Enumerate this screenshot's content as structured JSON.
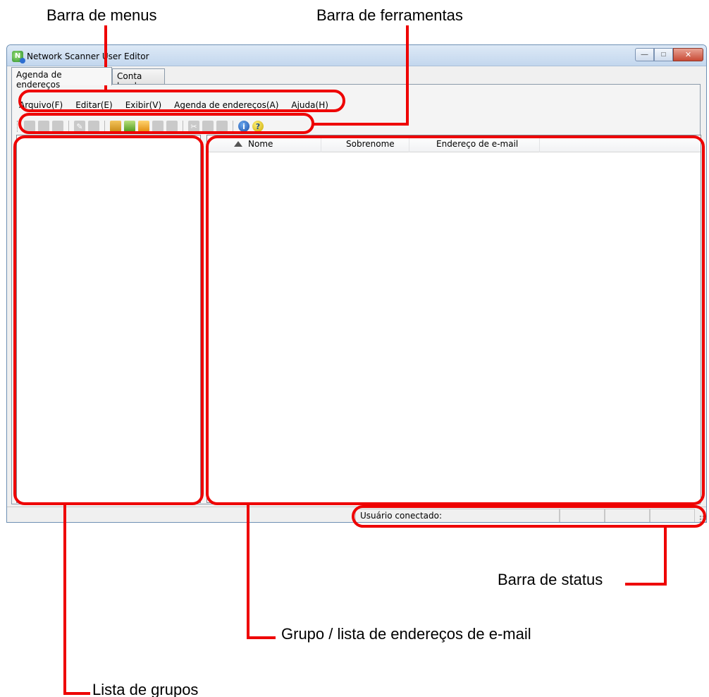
{
  "callouts": {
    "menubar": "Barra de menus",
    "toolbar": "Barra de ferramentas",
    "statusbar": "Barra de status",
    "address_list": "Grupo / lista de endereços de e-mail",
    "group_list": "Lista de grupos"
  },
  "window": {
    "title": "Network Scanner User Editor",
    "buttons": [
      "minimize",
      "maximize",
      "close"
    ]
  },
  "tabs": [
    {
      "label": "Agenda de endereços",
      "active": true
    },
    {
      "label": "Conta local",
      "active": false
    }
  ],
  "menubar": {
    "items": [
      "Arquivo(F)",
      "Editar(E)",
      "Exibir(V)",
      "Agenda de endereços(A)",
      "Ajuda(H)"
    ]
  },
  "toolbar": {
    "icons": [
      "new-user-icon",
      "new-group-icon",
      "add-member-icon",
      "edit-icon",
      "delete-icon",
      "import-icon",
      "open-book-icon",
      "open-folder-icon",
      "print-icon",
      "save-icon",
      "cut-icon",
      "copy-icon",
      "paste-icon",
      "info-icon",
      "help-icon"
    ]
  },
  "address_table": {
    "columns": [
      "Nome",
      "Sobrenome",
      "Endereço de e-mail"
    ],
    "sort_column": "Nome",
    "sort_direction": "ascending",
    "rows": []
  },
  "statusbar": {
    "logged_user_label": "Usuário conectado:"
  },
  "colors": {
    "highlight": "#ee0000",
    "window_frame": "#6d8fb4"
  }
}
